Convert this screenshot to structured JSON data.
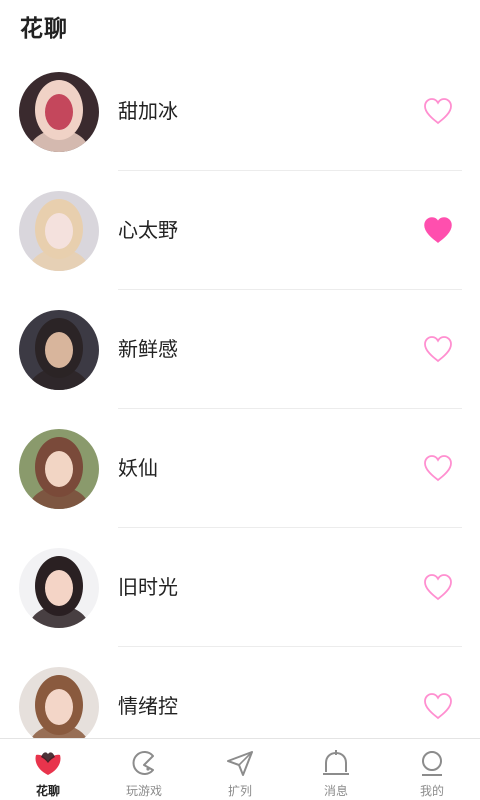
{
  "header": {
    "title": "花聊"
  },
  "colors": {
    "accent": "#ff4fae",
    "heart_outline": "#ff8fd0",
    "tab_inactive": "#8c8c8c",
    "tab_logo_red": "#e8344c"
  },
  "users": [
    {
      "name": "甜加冰",
      "liked": false,
      "avatar_colors": [
        "#3a2a2e",
        "#f0d2c6",
        "#c4475c"
      ]
    },
    {
      "name": "心太野",
      "liked": true,
      "avatar_colors": [
        "#d9d6dc",
        "#e8cfae",
        "#f4e1dd"
      ]
    },
    {
      "name": "新鲜感",
      "liked": false,
      "avatar_colors": [
        "#3c3a44",
        "#2b2426",
        "#d8b59c"
      ]
    },
    {
      "name": "妖仙",
      "liked": false,
      "avatar_colors": [
        "#8a9a6c",
        "#7a4a3a",
        "#f2d5c4"
      ]
    },
    {
      "name": "旧时光",
      "liked": false,
      "avatar_colors": [
        "#f2f2f4",
        "#2a2022",
        "#f4d4c6"
      ]
    },
    {
      "name": "情绪控",
      "liked": false,
      "avatar_colors": [
        "#e6e0dc",
        "#8a5a3e",
        "#f3d6c8"
      ]
    }
  ],
  "tabs": [
    {
      "label": "花聊",
      "icon": "flower-chat-icon",
      "active": true
    },
    {
      "label": "玩游戏",
      "icon": "game-icon",
      "active": false
    },
    {
      "label": "扩列",
      "icon": "send-icon",
      "active": false
    },
    {
      "label": "消息",
      "icon": "bell-icon",
      "active": false
    },
    {
      "label": "我的",
      "icon": "profile-icon",
      "active": false
    }
  ]
}
